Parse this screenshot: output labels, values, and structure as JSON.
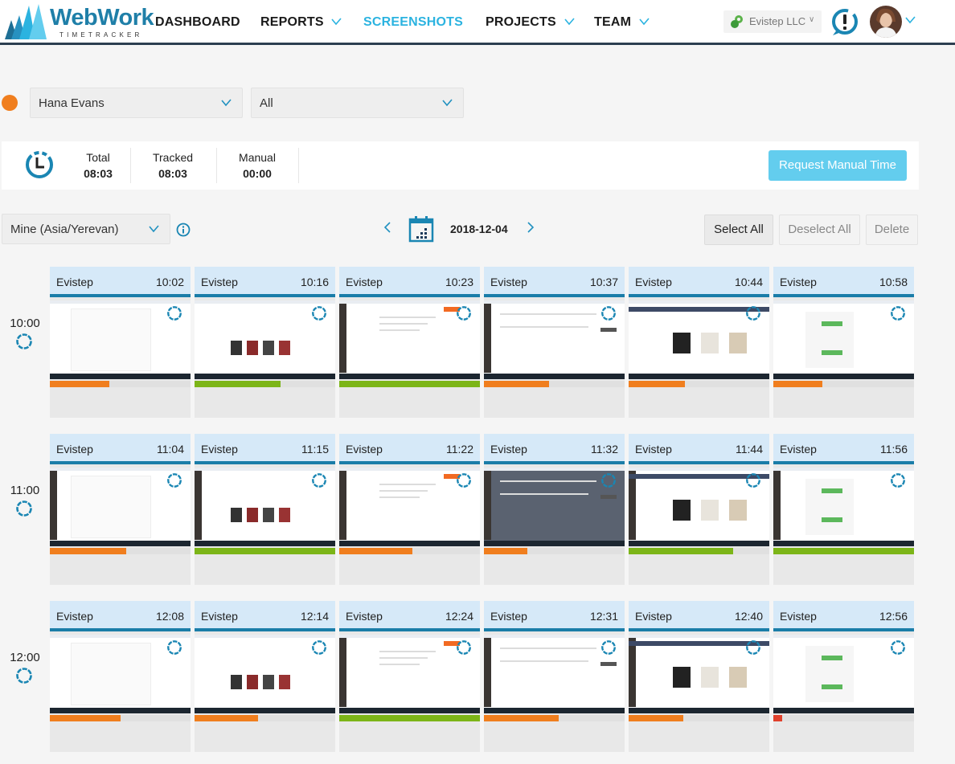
{
  "header": {
    "logo_title": "WebWork",
    "logo_subtitle": "TIMETRACKER",
    "nav": [
      {
        "label": "DASHBOARD",
        "dropdown": false,
        "active": false
      },
      {
        "label": "REPORTS",
        "dropdown": true,
        "active": false
      },
      {
        "label": "SCREENSHOTS",
        "dropdown": false,
        "active": true
      },
      {
        "label": "PROJECTS",
        "dropdown": true,
        "active": false
      },
      {
        "label": "TEAM",
        "dropdown": true,
        "active": false
      }
    ],
    "company": "Evistep  LLC",
    "alert_icon": "notification-alert-icon",
    "avatar_icon": "user-avatar"
  },
  "filters": {
    "user_status_color": "#f07e1e",
    "user": "Hana  Evans",
    "project": "All"
  },
  "summary": {
    "total_label": "Total",
    "total_value": "08:03",
    "tracked_label": "Tracked",
    "tracked_value": "08:03",
    "manual_label": "Manual",
    "manual_value": "00:00",
    "request_button": "Request  Manual  Time"
  },
  "toolbar": {
    "timezone": "Mine  (Asia/Yerevan)",
    "date": "2018-12-04",
    "select_all": "Select  All",
    "deselect_all": "Deselect  All",
    "delete": "Delete"
  },
  "colors": {
    "accent": "#2bb3e0",
    "header_dark": "#2c3e50",
    "card_header": "#d6e9f8",
    "card_stripe": "#1a7da8",
    "activity_high": "#7cb518",
    "activity_mid": "#f07e1e",
    "activity_low": "#e0412c"
  },
  "hours": [
    {
      "label": "10:00",
      "shots": [
        {
          "project": "Evistep",
          "time": "10:02",
          "activity": 42,
          "level": "mid"
        },
        {
          "project": "Evistep",
          "time": "10:16",
          "activity": 61,
          "level": "high"
        },
        {
          "project": "Evistep",
          "time": "10:23",
          "activity": 100,
          "level": "high"
        },
        {
          "project": "Evistep",
          "time": "10:37",
          "activity": 46,
          "level": "mid"
        },
        {
          "project": "Evistep",
          "time": "10:44",
          "activity": 40,
          "level": "mid"
        },
        {
          "project": "Evistep",
          "time": "10:58",
          "activity": 35,
          "level": "mid"
        }
      ]
    },
    {
      "label": "11:00",
      "shots": [
        {
          "project": "Evistep",
          "time": "11:04",
          "activity": 54,
          "level": "mid"
        },
        {
          "project": "Evistep",
          "time": "11:15",
          "activity": 100,
          "level": "high"
        },
        {
          "project": "Evistep",
          "time": "11:22",
          "activity": 52,
          "level": "mid"
        },
        {
          "project": "Evistep",
          "time": "11:32",
          "activity": 31,
          "level": "mid"
        },
        {
          "project": "Evistep",
          "time": "11:44",
          "activity": 74,
          "level": "high"
        },
        {
          "project": "Evistep",
          "time": "11:56",
          "activity": 100,
          "level": "high"
        }
      ]
    },
    {
      "label": "12:00",
      "shots": [
        {
          "project": "Evistep",
          "time": "12:08",
          "activity": 50,
          "level": "mid"
        },
        {
          "project": "Evistep",
          "time": "12:14",
          "activity": 45,
          "level": "mid"
        },
        {
          "project": "Evistep",
          "time": "12:24",
          "activity": 100,
          "level": "high"
        },
        {
          "project": "Evistep",
          "time": "12:31",
          "activity": 53,
          "level": "mid"
        },
        {
          "project": "Evistep",
          "time": "12:40",
          "activity": 39,
          "level": "mid"
        },
        {
          "project": "Evistep",
          "time": "12:56",
          "activity": 6,
          "level": "low"
        }
      ]
    }
  ]
}
